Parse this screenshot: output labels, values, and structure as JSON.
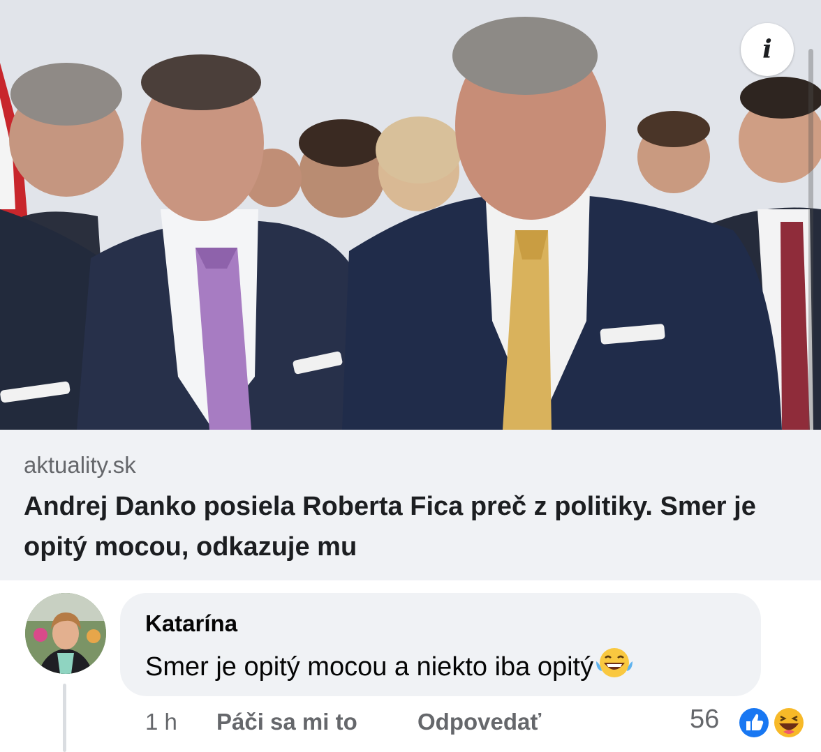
{
  "link_preview": {
    "domain": "aktuality.sk",
    "headline": "Andrej Danko posiela Roberta Fica preč z politiky. Smer je opitý mocou, odkazuje mu",
    "info_icon": "info-icon"
  },
  "comment": {
    "author": "Katarína",
    "text": "Smer je opitý mocou a niekto iba opitý",
    "emoji": "laughing-tears-emoji",
    "actions": {
      "time": "1 h",
      "like": "Páči sa mi to",
      "reply": "Odpovedať"
    },
    "reactions": {
      "count": "56",
      "types": [
        "like-reaction-icon",
        "haha-reaction-icon"
      ]
    }
  },
  "colors": {
    "card_bg": "#f0f2f5",
    "secondary_text": "#65676b",
    "primary_text": "#1c1e21",
    "like_blue": "#1877f2",
    "haha_yellow": "#f7b928"
  }
}
